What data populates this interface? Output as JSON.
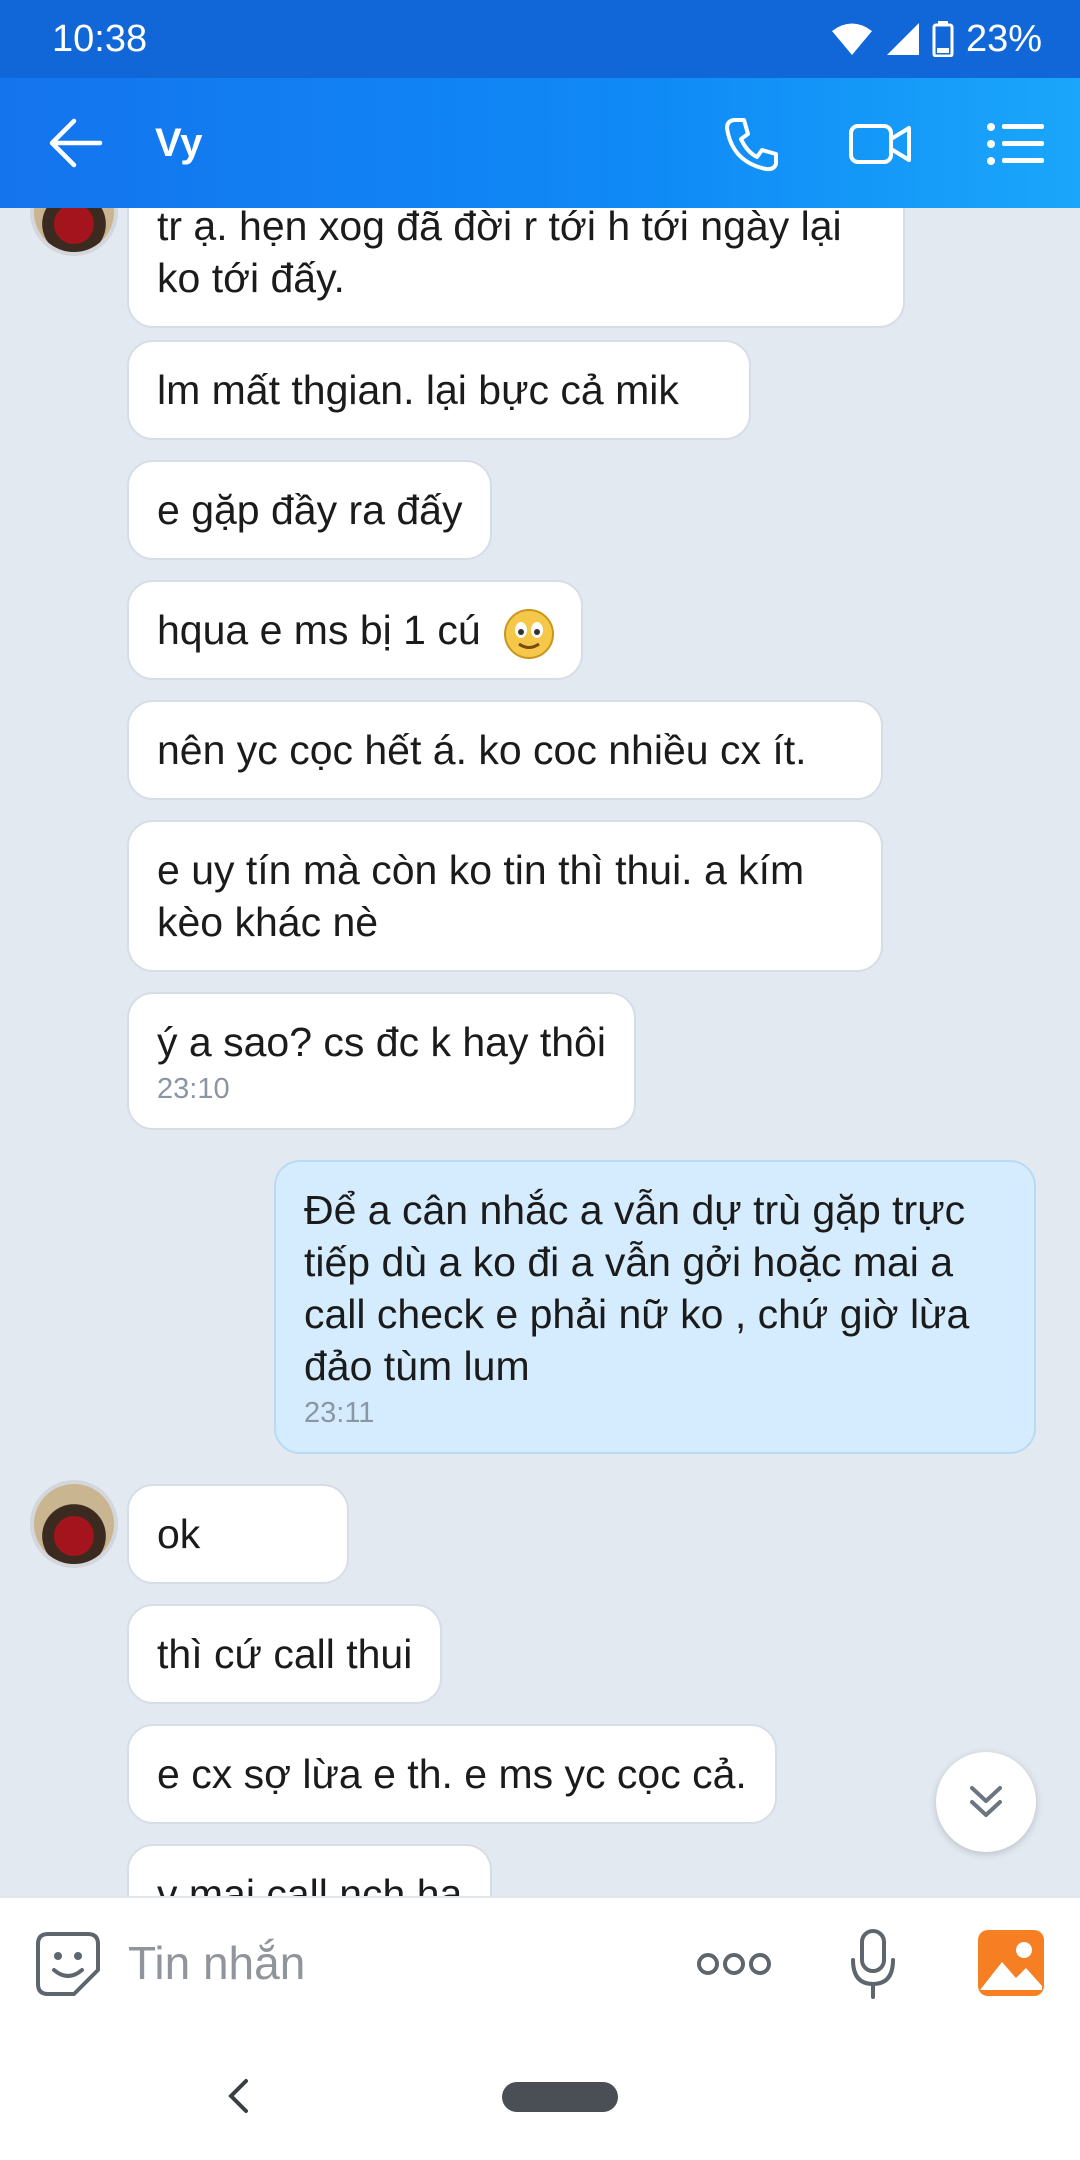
{
  "status": {
    "time": "10:38",
    "battery": "23%"
  },
  "header": {
    "title": "Vy"
  },
  "messages": [
    {
      "text": "tr ạ. hẹn xog đã đời r tới h tới ngày lại ko tới đấy."
    },
    {
      "text": "lm mất thgian. lại bực cả mik"
    },
    {
      "text": "e gặp đầy ra đấy"
    },
    {
      "text": "hqua e ms bị 1 cú"
    },
    {
      "text": "nên yc cọc hết á. ko coc nhiều cx ít."
    },
    {
      "text": "e uy tín mà còn ko tin thì thui. a kím kèo khác nè"
    },
    {
      "text": "ý a sao? cs đc k hay thôi",
      "time": "23:10"
    },
    {
      "text": "Để a cân nhắc a vẫn dự trù gặp trực tiếp dù a ko đi a vẫn gởi hoặc mai a call check e phải nữ ko , chứ giờ lừa đảo tùm lum",
      "time": "23:11"
    },
    {
      "text": "ok"
    },
    {
      "text": "thì cứ call thui"
    },
    {
      "text": "e cx sợ lừa e th. e ms yc cọc cả."
    },
    {
      "text": "v mai call nch hạ"
    }
  ],
  "input": {
    "placeholder": "Tin nhắn"
  },
  "icons": {
    "back": "arrow-left-icon",
    "call": "phone-icon",
    "video": "video-camera-icon",
    "menu": "list-icon",
    "emoji": "sticker-icon",
    "more": "more-dots-icon",
    "mic": "microphone-icon",
    "image": "image-icon",
    "scroll": "chevron-double-down-icon"
  },
  "colors": {
    "header": "#1474ee",
    "sent_bubble": "#d4ecfd",
    "background": "#e2e9f1"
  }
}
